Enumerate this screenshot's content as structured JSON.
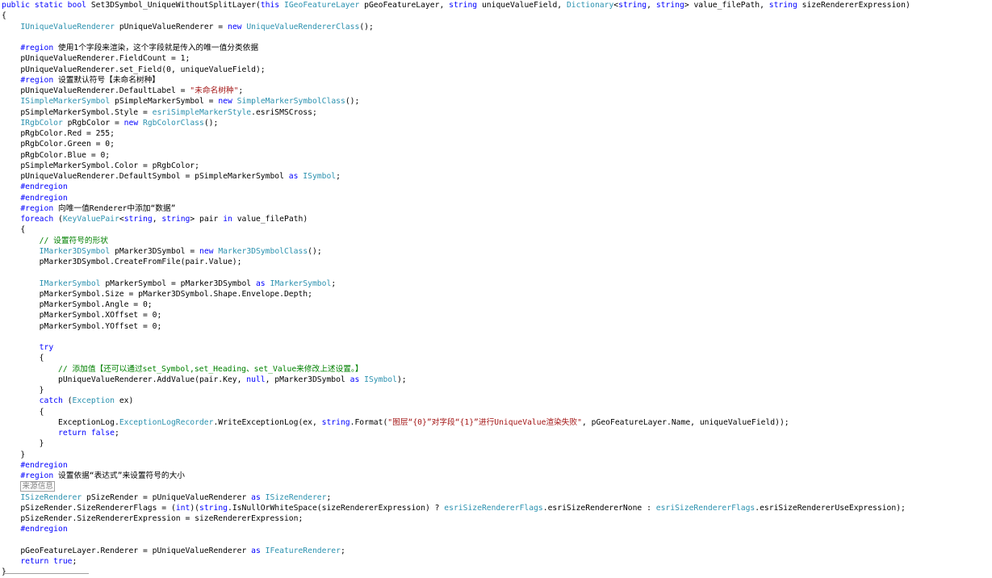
{
  "editor": {
    "language": "C#",
    "colors": {
      "keyword": "#0000ff",
      "type": "#2b91af",
      "comment": "#008000",
      "string": "#a31515",
      "text": "#000000",
      "background": "#ffffff"
    },
    "lines": [
      [
        [
          "k",
          "public static bool"
        ],
        [
          "n",
          " Set3DSymbol_UniqueWithoutSplitLayer("
        ],
        [
          "k",
          "this"
        ],
        [
          "n",
          " "
        ],
        [
          "t",
          "IGeoFeatureLayer"
        ],
        [
          "n",
          " pGeoFeatureLayer, "
        ],
        [
          "k",
          "string"
        ],
        [
          "n",
          " uniqueValueField, "
        ],
        [
          "t",
          "Dictionary"
        ],
        [
          "n",
          "<"
        ],
        [
          "k",
          "string"
        ],
        [
          "n",
          ", "
        ],
        [
          "k",
          "string"
        ],
        [
          "n",
          "> value_filePath, "
        ],
        [
          "k",
          "string"
        ],
        [
          "n",
          " sizeRendererExpression)"
        ]
      ],
      [
        [
          "n",
          "{"
        ]
      ],
      [
        [
          "n",
          "    "
        ],
        [
          "t",
          "IUniqueValueRenderer"
        ],
        [
          "n",
          " pUniqueValueRenderer = "
        ],
        [
          "k",
          "new"
        ],
        [
          "n",
          " "
        ],
        [
          "t",
          "UniqueValueRendererClass"
        ],
        [
          "n",
          "();"
        ]
      ],
      [
        [
          "n",
          ""
        ]
      ],
      [
        [
          "n",
          "    "
        ],
        [
          "k",
          "#region"
        ],
        [
          "n",
          " 使用1个字段来渲染，这个字段就是传入的唯一值分类依据"
        ]
      ],
      [
        [
          "n",
          "    pUniqueValueRenderer.FieldCount = 1;"
        ]
      ],
      [
        [
          "n",
          "    pUniqueValueRenderer.set_Field(0, uniqueValueField);"
        ]
      ],
      [
        [
          "n",
          "    "
        ],
        [
          "k",
          "#region"
        ],
        [
          "n",
          " 设置默认符号【未命名树种】"
        ]
      ],
      [
        [
          "n",
          "    pUniqueValueRenderer.DefaultLabel = "
        ],
        [
          "s",
          "\"未命名树种\""
        ],
        [
          "n",
          ";"
        ]
      ],
      [
        [
          "n",
          "    "
        ],
        [
          "t",
          "ISimpleMarkerSymbol"
        ],
        [
          "n",
          " pSimpleMarkerSymbol = "
        ],
        [
          "k",
          "new"
        ],
        [
          "n",
          " "
        ],
        [
          "t",
          "SimpleMarkerSymbolClass"
        ],
        [
          "n",
          "();"
        ]
      ],
      [
        [
          "n",
          "    pSimpleMarkerSymbol.Style = "
        ],
        [
          "t",
          "esriSimpleMarkerStyle"
        ],
        [
          "n",
          ".esriSMSCross;"
        ]
      ],
      [
        [
          "n",
          "    "
        ],
        [
          "t",
          "IRgbColor"
        ],
        [
          "n",
          " pRgbColor = "
        ],
        [
          "k",
          "new"
        ],
        [
          "n",
          " "
        ],
        [
          "t",
          "RgbColorClass"
        ],
        [
          "n",
          "();"
        ]
      ],
      [
        [
          "n",
          "    pRgbColor.Red = 255;"
        ]
      ],
      [
        [
          "n",
          "    pRgbColor.Green = 0;"
        ]
      ],
      [
        [
          "n",
          "    pRgbColor.Blue = 0;"
        ]
      ],
      [
        [
          "n",
          "    pSimpleMarkerSymbol.Color = pRgbColor;"
        ]
      ],
      [
        [
          "n",
          "    pUniqueValueRenderer.DefaultSymbol = pSimpleMarkerSymbol "
        ],
        [
          "k",
          "as"
        ],
        [
          "n",
          " "
        ],
        [
          "t",
          "ISymbol"
        ],
        [
          "n",
          ";"
        ]
      ],
      [
        [
          "n",
          "    "
        ],
        [
          "k",
          "#endregion"
        ]
      ],
      [
        [
          "n",
          "    "
        ],
        [
          "k",
          "#endregion"
        ]
      ],
      [
        [
          "n",
          "    "
        ],
        [
          "k",
          "#region"
        ],
        [
          "n",
          " 向唯一值Renderer中添加“数据”"
        ]
      ],
      [
        [
          "n",
          "    "
        ],
        [
          "k",
          "foreach"
        ],
        [
          "n",
          " ("
        ],
        [
          "t",
          "KeyValuePair"
        ],
        [
          "n",
          "<"
        ],
        [
          "k",
          "string"
        ],
        [
          "n",
          ", "
        ],
        [
          "k",
          "string"
        ],
        [
          "n",
          "> pair "
        ],
        [
          "k",
          "in"
        ],
        [
          "n",
          " value_filePath)"
        ]
      ],
      [
        [
          "n",
          "    {"
        ]
      ],
      [
        [
          "n",
          "        "
        ],
        [
          "c",
          "// 设置符号的形状"
        ]
      ],
      [
        [
          "n",
          "        "
        ],
        [
          "t",
          "IMarker3DSymbol"
        ],
        [
          "n",
          " pMarker3DSymbol = "
        ],
        [
          "k",
          "new"
        ],
        [
          "n",
          " "
        ],
        [
          "t",
          "Marker3DSymbolClass"
        ],
        [
          "n",
          "();"
        ]
      ],
      [
        [
          "n",
          "        pMarker3DSymbol.CreateFromFile(pair.Value);"
        ]
      ],
      [
        [
          "n",
          ""
        ]
      ],
      [
        [
          "n",
          "        "
        ],
        [
          "t",
          "IMarkerSymbol"
        ],
        [
          "n",
          " pMarkerSymbol = pMarker3DSymbol "
        ],
        [
          "k",
          "as"
        ],
        [
          "n",
          " "
        ],
        [
          "t",
          "IMarkerSymbol"
        ],
        [
          "n",
          ";"
        ]
      ],
      [
        [
          "n",
          "        pMarkerSymbol.Size = pMarker3DSymbol.Shape.Envelope.Depth;"
        ]
      ],
      [
        [
          "n",
          "        pMarkerSymbol.Angle = 0;"
        ]
      ],
      [
        [
          "n",
          "        pMarkerSymbol.XOffset = 0;"
        ]
      ],
      [
        [
          "n",
          "        pMarkerSymbol.YOffset = 0;"
        ]
      ],
      [
        [
          "n",
          ""
        ]
      ],
      [
        [
          "n",
          "        "
        ],
        [
          "k",
          "try"
        ]
      ],
      [
        [
          "n",
          "        {"
        ]
      ],
      [
        [
          "n",
          "            "
        ],
        [
          "c",
          "// 添加值【还可以通过set_Symbol,set_Heading、set_Value来修改上述设置。】"
        ]
      ],
      [
        [
          "n",
          "            pUniqueValueRenderer.AddValue(pair.Key, "
        ],
        [
          "k",
          "null"
        ],
        [
          "n",
          ", pMarker3DSymbol "
        ],
        [
          "k",
          "as"
        ],
        [
          "n",
          " "
        ],
        [
          "t",
          "ISymbol"
        ],
        [
          "n",
          ");"
        ]
      ],
      [
        [
          "n",
          "        }"
        ]
      ],
      [
        [
          "n",
          "        "
        ],
        [
          "k",
          "catch"
        ],
        [
          "n",
          " ("
        ],
        [
          "t",
          "Exception"
        ],
        [
          "n",
          " ex)"
        ]
      ],
      [
        [
          "n",
          "        {"
        ]
      ],
      [
        [
          "n",
          "            ExceptionLog."
        ],
        [
          "t",
          "ExceptionLogRecorder"
        ],
        [
          "n",
          ".WriteExceptionLog(ex, "
        ],
        [
          "k",
          "string"
        ],
        [
          "n",
          ".Format("
        ],
        [
          "s",
          "\"图层“{0}”对字段“{1}”进行UniqueValue渲染失败\""
        ],
        [
          "n",
          ", pGeoFeatureLayer.Name, uniqueValueField));"
        ]
      ],
      [
        [
          "n",
          "            "
        ],
        [
          "k",
          "return false"
        ],
        [
          "n",
          ";"
        ]
      ],
      [
        [
          "n",
          "        }"
        ]
      ],
      [
        [
          "n",
          "    }"
        ]
      ],
      [
        [
          "n",
          "    "
        ],
        [
          "k",
          "#endregion"
        ]
      ],
      [
        [
          "n",
          "    "
        ],
        [
          "k",
          "#region"
        ],
        [
          "n",
          " 设置依据“表达式”来设置符号的大小"
        ]
      ],
      [
        [
          "n",
          "    "
        ],
        [
          "box",
          "来源信息"
        ]
      ],
      [
        [
          "n",
          "    "
        ],
        [
          "t",
          "ISizeRenderer"
        ],
        [
          "n",
          " pSizeRender = pUniqueValueRenderer "
        ],
        [
          "k",
          "as"
        ],
        [
          "n",
          " "
        ],
        [
          "t",
          "ISizeRenderer"
        ],
        [
          "n",
          ";"
        ]
      ],
      [
        [
          "n",
          "    pSizeRender.SizeRendererFlags = ("
        ],
        [
          "k",
          "int"
        ],
        [
          "n",
          ")("
        ],
        [
          "k",
          "string"
        ],
        [
          "n",
          ".IsNullOrWhiteSpace(sizeRendererExpression) ? "
        ],
        [
          "t",
          "esriSizeRendererFlags"
        ],
        [
          "n",
          ".esriSizeRendererNone : "
        ],
        [
          "t",
          "esriSizeRendererFlags"
        ],
        [
          "n",
          ".esriSizeRendererUseExpression);"
        ]
      ],
      [
        [
          "n",
          "    pSizeRender.SizeRendererExpression = sizeRendererExpression;"
        ]
      ],
      [
        [
          "n",
          "    "
        ],
        [
          "k",
          "#endregion"
        ]
      ],
      [
        [
          "n",
          ""
        ]
      ],
      [
        [
          "n",
          "    pGeoFeatureLayer.Renderer = pUniqueValueRenderer "
        ],
        [
          "k",
          "as"
        ],
        [
          "n",
          " "
        ],
        [
          "t",
          "IFeatureRenderer"
        ],
        [
          "n",
          ";"
        ]
      ],
      [
        [
          "n",
          "    "
        ],
        [
          "k",
          "return true"
        ],
        [
          "n",
          ";"
        ]
      ],
      [
        [
          "n",
          "}"
        ]
      ]
    ]
  }
}
